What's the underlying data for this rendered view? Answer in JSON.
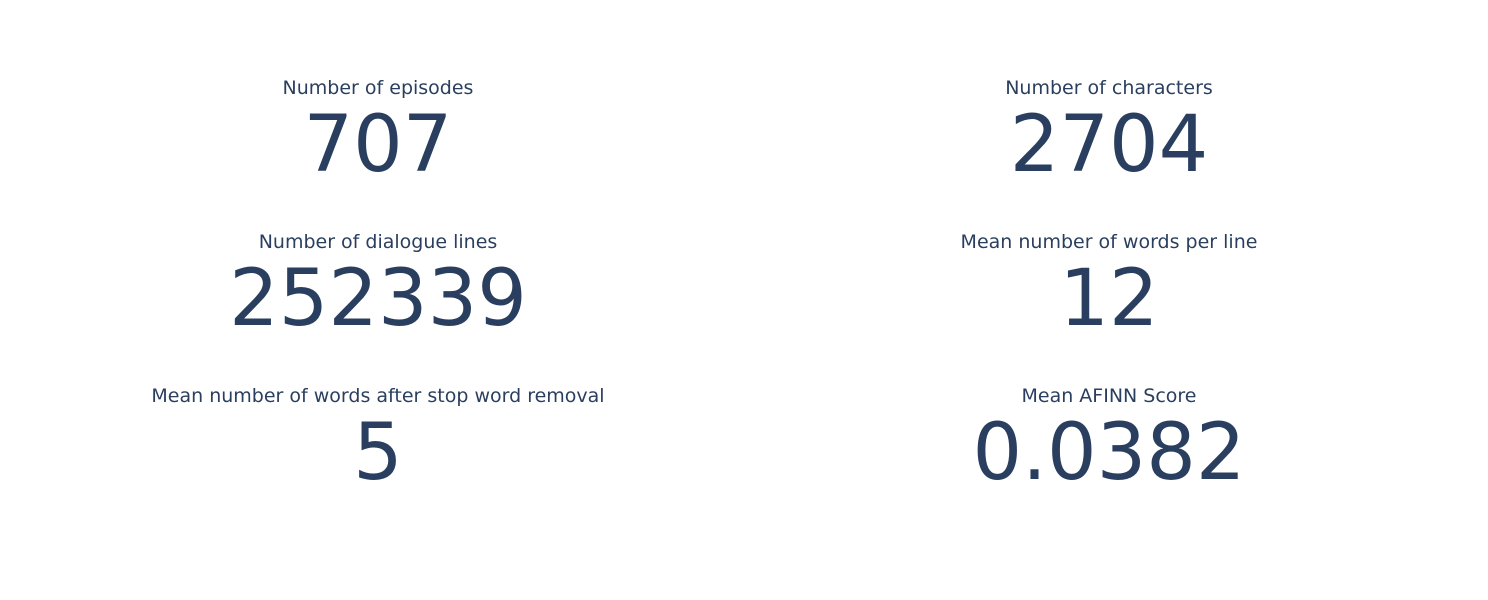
{
  "chart_data": {
    "type": "table",
    "indicators": [
      {
        "title": "Number of episodes",
        "value": "707"
      },
      {
        "title": "Number of characters",
        "value": "2704"
      },
      {
        "title": "Number of dialogue lines",
        "value": "252339"
      },
      {
        "title": "Mean number of words per line",
        "value": "12"
      },
      {
        "title": "Mean number of words after stop word removal",
        "value": "5"
      },
      {
        "title": "Mean AFINN Score",
        "value": "0.0382"
      }
    ],
    "text_color": "#2a3f5f",
    "background_color": "#ffffff"
  }
}
